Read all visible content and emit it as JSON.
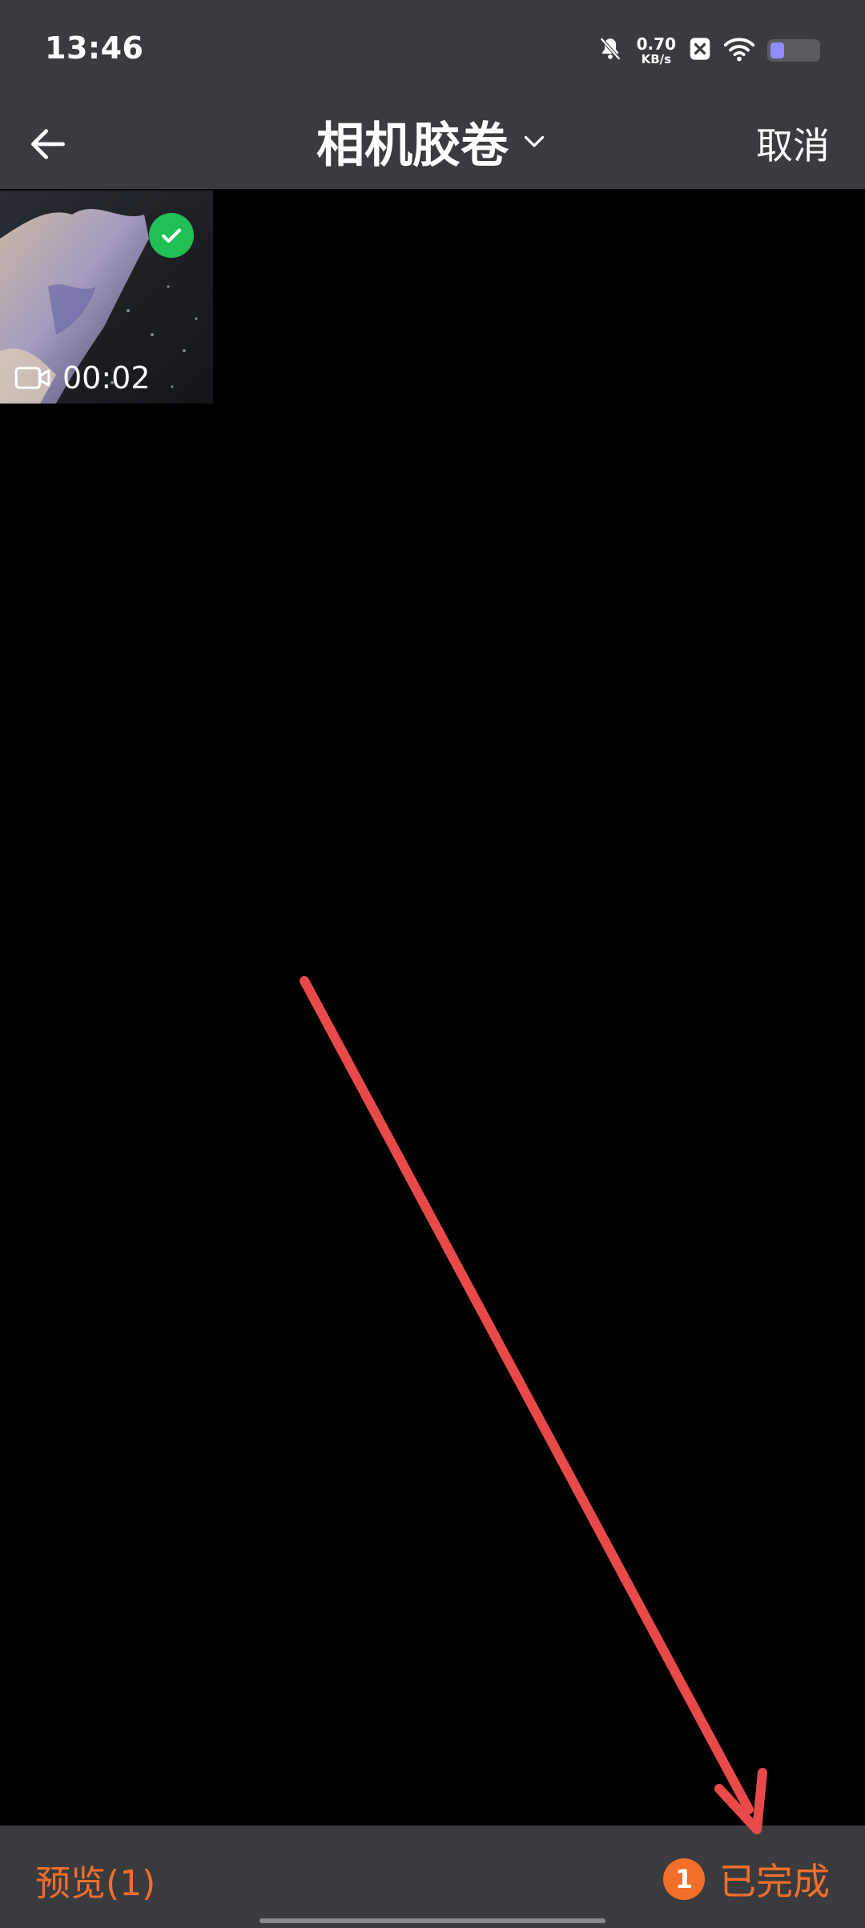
{
  "status_bar": {
    "time": "13:46",
    "netspeed_value": "0.70",
    "netspeed_unit": "KB/s",
    "icons": [
      "bell-muted-icon",
      "close-box-icon",
      "wifi-icon",
      "battery-icon"
    ],
    "battery_level": 0.3
  },
  "nav": {
    "title": "相机胶卷",
    "cancel_label": "取消",
    "icons": [
      "back-arrow-icon",
      "chevron-down-icon"
    ]
  },
  "grid": {
    "items": [
      {
        "type": "video",
        "duration": "00:02",
        "selected": true
      }
    ]
  },
  "bottom_bar": {
    "preview_label": "预览(1)",
    "selected_count": "1",
    "done_label": "已完成"
  },
  "colors": {
    "bar_bg": "#3a3b3f",
    "accent": "#f26e2b",
    "check_green": "#20c054",
    "annotation_red": "#e84a4a"
  }
}
